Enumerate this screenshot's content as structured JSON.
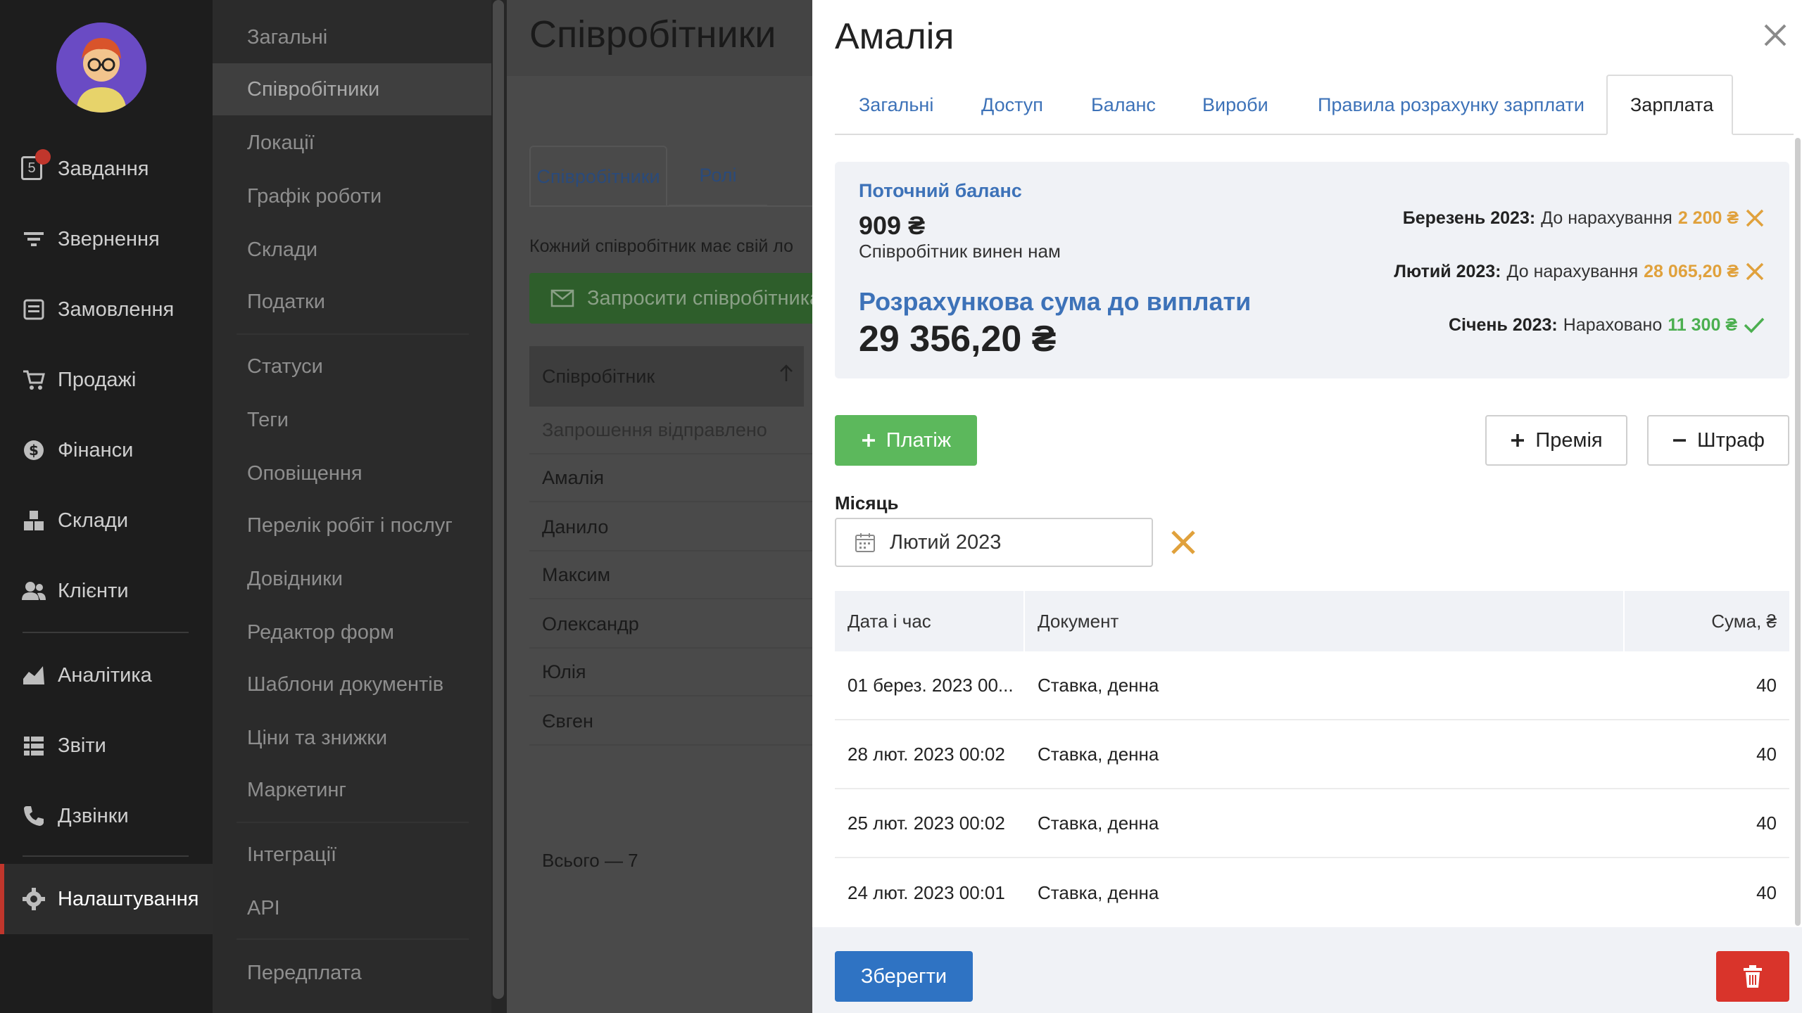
{
  "sidebar": {
    "items": [
      {
        "label": "Завдання",
        "icon": "tasks-icon",
        "badge": "5"
      },
      {
        "label": "Звернення",
        "icon": "funnel-icon"
      },
      {
        "label": "Замовлення",
        "icon": "orders-icon"
      },
      {
        "label": "Продажі",
        "icon": "cart-icon"
      },
      {
        "label": "Фінанси",
        "icon": "dollar-icon"
      },
      {
        "label": "Склади",
        "icon": "boxes-icon"
      },
      {
        "label": "Клієнти",
        "icon": "clients-icon"
      },
      {
        "label": "Аналітика",
        "icon": "chart-icon"
      },
      {
        "label": "Звіти",
        "icon": "reports-icon"
      },
      {
        "label": "Дзвінки",
        "icon": "phone-icon"
      },
      {
        "label": "Налаштування",
        "icon": "gear-icon",
        "active": true
      }
    ]
  },
  "submenu": {
    "items": [
      "Загальні",
      "Співробітники",
      "Локації",
      "Графік роботи",
      "Склади",
      "Податки",
      "Статуси",
      "Теги",
      "Оповіщення",
      "Перелік робіт і послуг",
      "Довідники",
      "Редактор форм",
      "Шаблони документів",
      "Ціни та знижки",
      "Маркетинг",
      "Інтеграції",
      "API",
      "Передплата"
    ],
    "active_index": 1
  },
  "employees_page": {
    "title": "Співробітники",
    "tabs": [
      "Співробітники",
      "Ролі"
    ],
    "description": "Кожний співробітник має свій ло",
    "invite_button": "Запросити співробітника",
    "table_header": "Співробітник",
    "rows": [
      "Запрошення відправлено",
      "Амалія",
      "Данило",
      "Максим",
      "Олександр",
      "Юлія",
      "Євген"
    ],
    "total": "Всього — 7"
  },
  "panel": {
    "title": "Амалія",
    "tabs": [
      "Загальні",
      "Доступ",
      "Баланс",
      "Вироби",
      "Правила розрахунку зарплати",
      "Зарплата"
    ],
    "active_tab": "Зарплата",
    "balance": {
      "label": "Поточний баланс",
      "value": "909 ₴",
      "note": "Співробітник винен нам",
      "calc_label": "Розрахункова сума до виплати",
      "calc_value": "29 356,20 ₴"
    },
    "months": [
      {
        "month": "Березень 2023:",
        "status": "До нарахування",
        "amount": "2 200 ₴",
        "state": "pending"
      },
      {
        "month": "Лютий 2023:",
        "status": "До нарахування",
        "amount": "28 065,20 ₴",
        "state": "pending"
      },
      {
        "month": "Січень 2023:",
        "status": "Нараховано",
        "amount": "11 300 ₴",
        "state": "done"
      }
    ],
    "buttons": {
      "payment": "Платіж",
      "bonus": "Премія",
      "fine": "Штраф",
      "save": "Зберегти"
    },
    "month_filter": {
      "label": "Місяць",
      "value": "Лютий 2023"
    },
    "table": {
      "headers": [
        "Дата і час",
        "Документ",
        "Сума, ₴"
      ],
      "rows": [
        {
          "date": "01 берез. 2023 00...",
          "doc": "Ставка, денна",
          "sum": "40"
        },
        {
          "date": "28 лют. 2023 00:02",
          "doc": "Ставка, денна",
          "sum": "40"
        },
        {
          "date": "25 лют. 2023 00:02",
          "doc": "Ставка, денна",
          "sum": "40"
        },
        {
          "date": "24 лют. 2023 00:01",
          "doc": "Ставка, денна",
          "sum": "40"
        }
      ]
    }
  },
  "colors": {
    "accent_blue": "#3d72b8",
    "green": "#5cb85c",
    "pending_orange": "#e0a13c",
    "danger_red": "#d9342b",
    "sidebar_bg": "#1d1d1d"
  }
}
